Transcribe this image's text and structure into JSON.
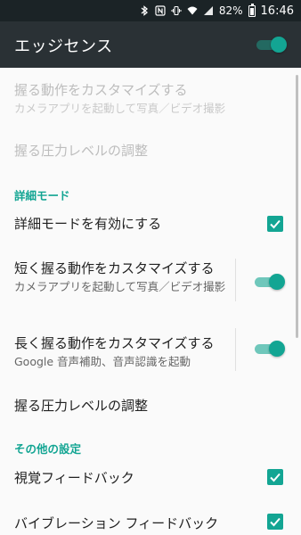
{
  "status_bar": {
    "battery_percent": "82%",
    "time": "16:46",
    "icons": [
      "bluetooth-icon",
      "nfc-icon",
      "vibrate-icon",
      "wifi-icon",
      "signal-icon",
      "battery-icon"
    ]
  },
  "toolbar": {
    "title": "エッジセンス",
    "master_switch_on": true
  },
  "prefs": {
    "squeeze_action": {
      "title": "握る動作をカスタマイズする",
      "summary": "カメラアプリを起動して写真／ビデオ撮影",
      "enabled": false
    },
    "pressure_level_basic": {
      "title": "握る圧力レベルの調整",
      "enabled": false
    },
    "advanced_header": "詳細モード",
    "enable_advanced": {
      "title": "詳細モードを有効にする",
      "checked": true
    },
    "short_squeeze": {
      "title": "短く握る動作をカスタマイズする",
      "summary": "カメラアプリを起動して写真／ビデオ撮影",
      "switch_on": true
    },
    "long_squeeze": {
      "title": "長く握る動作をカスタマイズする",
      "summary": "Google 音声補助、音声認識を起動",
      "switch_on": true
    },
    "pressure_level_advanced": {
      "title": "握る圧力レベルの調整"
    },
    "other_header": "その他の設定",
    "visual_feedback": {
      "title": "視覚フィードバック",
      "checked": true
    },
    "vibration_feedback": {
      "title": "バイブレーション フィードバック",
      "checked": true
    }
  },
  "colors": {
    "accent": "#13a593",
    "toolbar": "#2a3135",
    "status_bar": "#1b2326"
  }
}
